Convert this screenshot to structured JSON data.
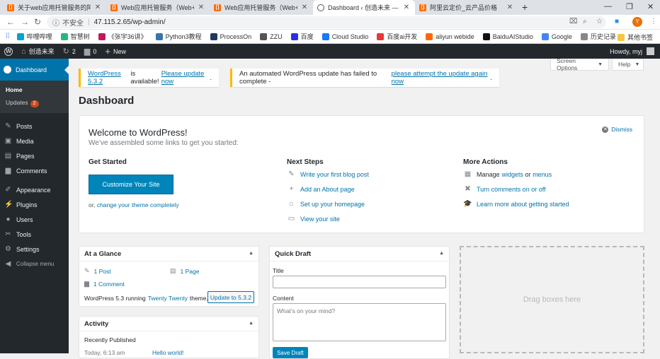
{
  "browser": {
    "tabs": [
      {
        "title": "关于web应用托管服务的阿里云",
        "icon": "cn-cloud-icon",
        "active": false
      },
      {
        "title": "Web应用托管服务（Web+）-管",
        "icon": "cn-cloud-icon",
        "active": false
      },
      {
        "title": "Web应用托管服务（Web+）",
        "icon": "cn-cloud-icon",
        "active": false
      },
      {
        "title": "Dashboard ‹ 创造未来 — Wor",
        "icon": "wordpress-icon",
        "active": true
      },
      {
        "title": "阿里云定价_云产品价格",
        "icon": "cn-cloud-icon",
        "active": false
      }
    ],
    "new_tab": "+",
    "url_insecure": "不安全",
    "url": "47.115.2.65/wp-admin/",
    "profile_initial": "Y",
    "bookmarks": [
      {
        "label": "哔哩哔哩",
        "color": "#00a1d6"
      },
      {
        "label": "智慧树",
        "color": "#2ab57d"
      },
      {
        "label": "《张宇36讲》",
        "color": "#c2185b"
      },
      {
        "label": "Python3教程",
        "color": "#3776ab"
      },
      {
        "label": "ProcessOn",
        "color": "#1f3a5f"
      },
      {
        "label": "ZZU",
        "color": "#555555"
      },
      {
        "label": "百度",
        "color": "#2932e1"
      },
      {
        "label": "Cloud Studio",
        "color": "#1677ff"
      },
      {
        "label": "百度ai开发",
        "color": "#e53935"
      },
      {
        "label": "aliyun webide",
        "color": "#ff6a00"
      },
      {
        "label": "BaiduAIStudio",
        "color": "#111111"
      },
      {
        "label": "Google",
        "color": "#4285f4"
      },
      {
        "label": "历史记录",
        "color": "#888888"
      }
    ],
    "other_bookmarks": "其他书签"
  },
  "adminbar": {
    "site_name": "创造未来",
    "updates_count": "2",
    "comments_count": "0",
    "new_label": "New",
    "howdy": "Howdy, myj"
  },
  "sidebar": {
    "dashboard": "Dashboard",
    "home": "Home",
    "updates": "Updates",
    "updates_badge": "2",
    "items": [
      {
        "label": "Posts",
        "icon": "pin-icon"
      },
      {
        "label": "Media",
        "icon": "media-icon"
      },
      {
        "label": "Pages",
        "icon": "pages-icon"
      },
      {
        "label": "Comments",
        "icon": "comment-icon"
      },
      {
        "label": "Appearance",
        "icon": "brush-icon"
      },
      {
        "label": "Plugins",
        "icon": "plug-icon"
      },
      {
        "label": "Users",
        "icon": "user-icon"
      },
      {
        "label": "Tools",
        "icon": "wrench-icon"
      },
      {
        "label": "Settings",
        "icon": "settings-icon"
      }
    ],
    "collapse": "Collapse menu"
  },
  "notices": {
    "n1_pre": "WordPress 5.3.2",
    "n1_mid": " is available! ",
    "n1_link": "Please update now",
    "n1_post": ".",
    "n2_pre": "An automated WordPress update has failed to complete - ",
    "n2_link": "please attempt the update again now",
    "n2_post": "."
  },
  "screen_options": "Screen Options",
  "help": "Help",
  "page_title": "Dashboard",
  "welcome": {
    "title": "Welcome to WordPress!",
    "about": "We’ve assembled some links to get you started:",
    "dismiss": "Dismiss",
    "get_started": "Get Started",
    "customize": "Customize Your Site",
    "or": "or, ",
    "change_theme": "change your theme completely",
    "next_steps": "Next Steps",
    "next": [
      {
        "label": "Write your first blog post",
        "icon": "edit-icon"
      },
      {
        "label": "Add an About page",
        "icon": "plus-icon"
      },
      {
        "label": "Set up your homepage",
        "icon": "home-icon"
      },
      {
        "label": "View your site",
        "icon": "view-icon"
      }
    ],
    "more_actions": "More Actions",
    "manage_pre": "Manage ",
    "manage_widgets": "widgets",
    "manage_or": " or ",
    "manage_menus": "menus",
    "comments_toggle": "Turn comments on or off",
    "learn": "Learn more about getting started"
  },
  "glance": {
    "title": "At a Glance",
    "posts": "1 Post",
    "pages": "1 Page",
    "comments": "1 Comment",
    "running_pre": "WordPress 5.3 running ",
    "theme": "Twenty Twenty",
    "running_post": " theme.",
    "update_btn": "Update to 5.3.2"
  },
  "activity": {
    "title": "Activity",
    "recently": "Recently Published",
    "date": "Today, 6:13 am",
    "post": "Hello world!"
  },
  "quickdraft": {
    "title": "Quick Draft",
    "title_label": "Title",
    "content_label": "Content",
    "content_placeholder": "What’s on your mind?",
    "save": "Save Draft"
  },
  "dropzone": "Drag boxes here"
}
